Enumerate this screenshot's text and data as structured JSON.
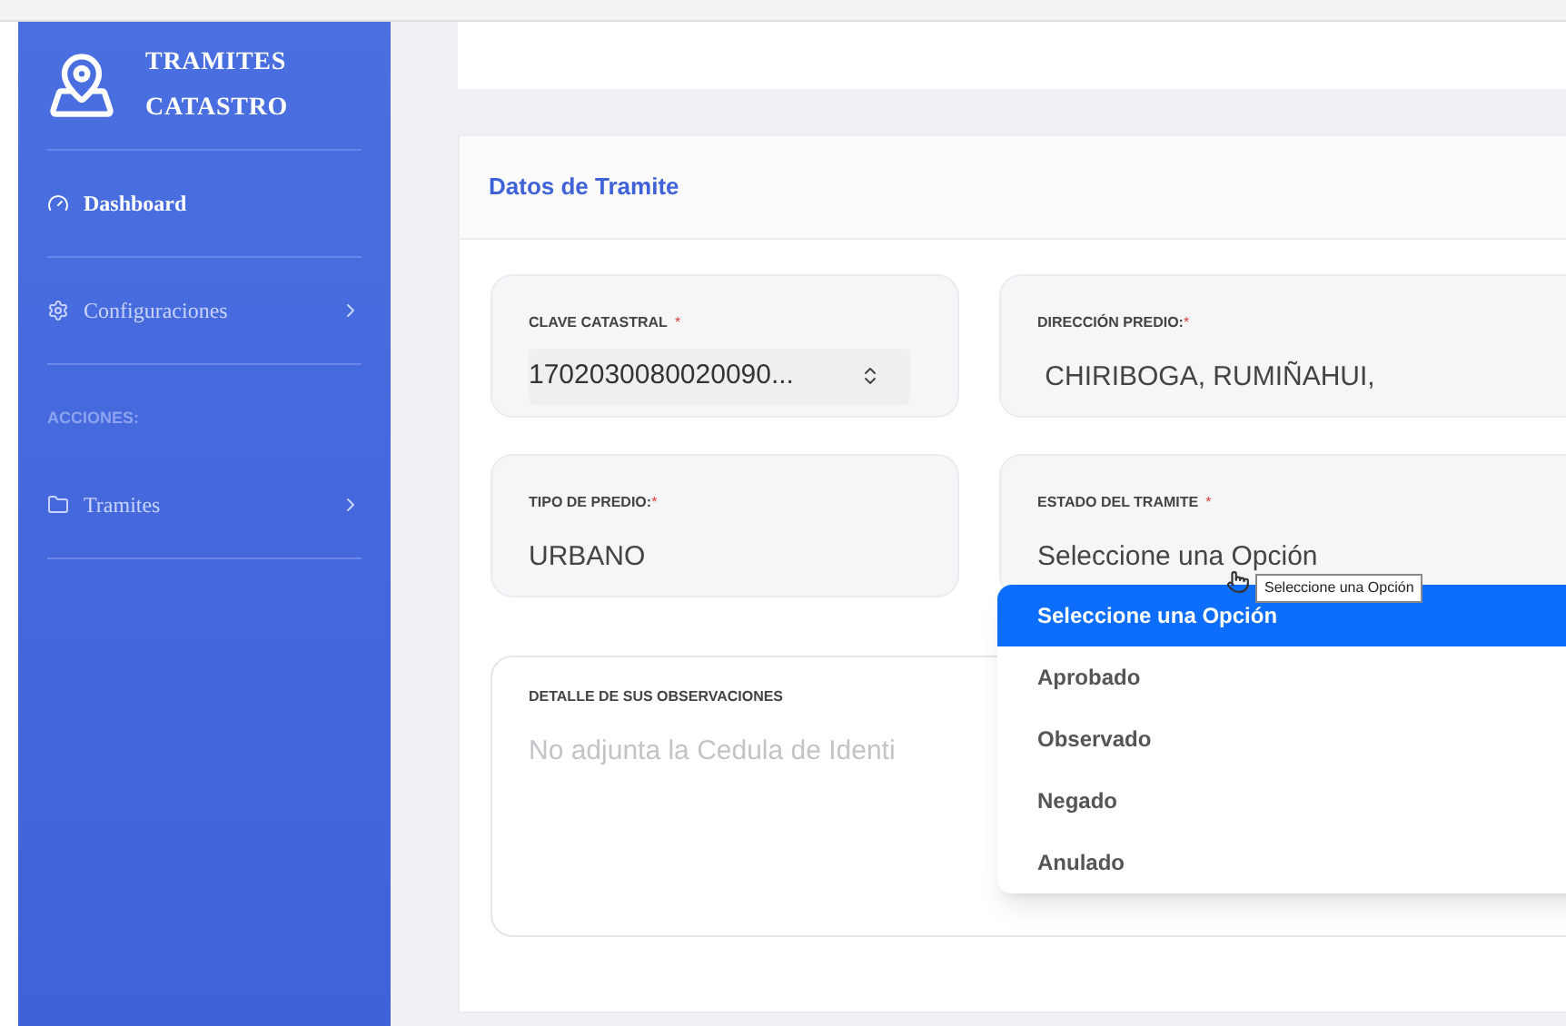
{
  "sidebar": {
    "brand": [
      "TRAMITES",
      "CATASTRO"
    ],
    "items": [
      {
        "kind": "dashboard",
        "label": "Dashboard",
        "selected": true
      },
      {
        "kind": "settings",
        "label": "Configuraciones",
        "selected": false,
        "expandable": true
      },
      {
        "kind": "heading",
        "label": "ACCIONES:"
      },
      {
        "kind": "folder",
        "label": "Tramites",
        "selected": false,
        "expandable": true
      }
    ]
  },
  "card": {
    "title": "Datos de Tramite",
    "fields": [
      {
        "label": "CLAVE CATASTRAL",
        "asterisk": "*",
        "value": "1702030080020090...",
        "kind": "select"
      },
      {
        "label": "DIRECCIÓN PREDIO:",
        "asterisk": "*",
        "value": " CHIRIBOGA, RUMIÑAHUI,",
        "kind": "text"
      },
      {
        "label": "TIPO DE PREDIO:",
        "asterisk": "*",
        "value": "URBANO",
        "kind": "text"
      },
      {
        "label": "ESTADO DEL TRAMITE",
        "asterisk": "*",
        "value": "Seleccione una Opción",
        "kind": "text"
      }
    ],
    "observations": {
      "label": "DETALLE DE SUS OBSERVACIONES",
      "placeholder": "No adjunta la Cedula de Identi"
    },
    "dropdown": {
      "options": [
        {
          "label": "Seleccione una Opción",
          "selected": true
        },
        {
          "label": "Aprobado",
          "selected": false
        },
        {
          "label": "Observado",
          "selected": false
        },
        {
          "label": "Negado",
          "selected": false
        },
        {
          "label": "Anulado",
          "selected": false
        }
      ]
    },
    "tooltip": "Seleccione una Opción"
  }
}
